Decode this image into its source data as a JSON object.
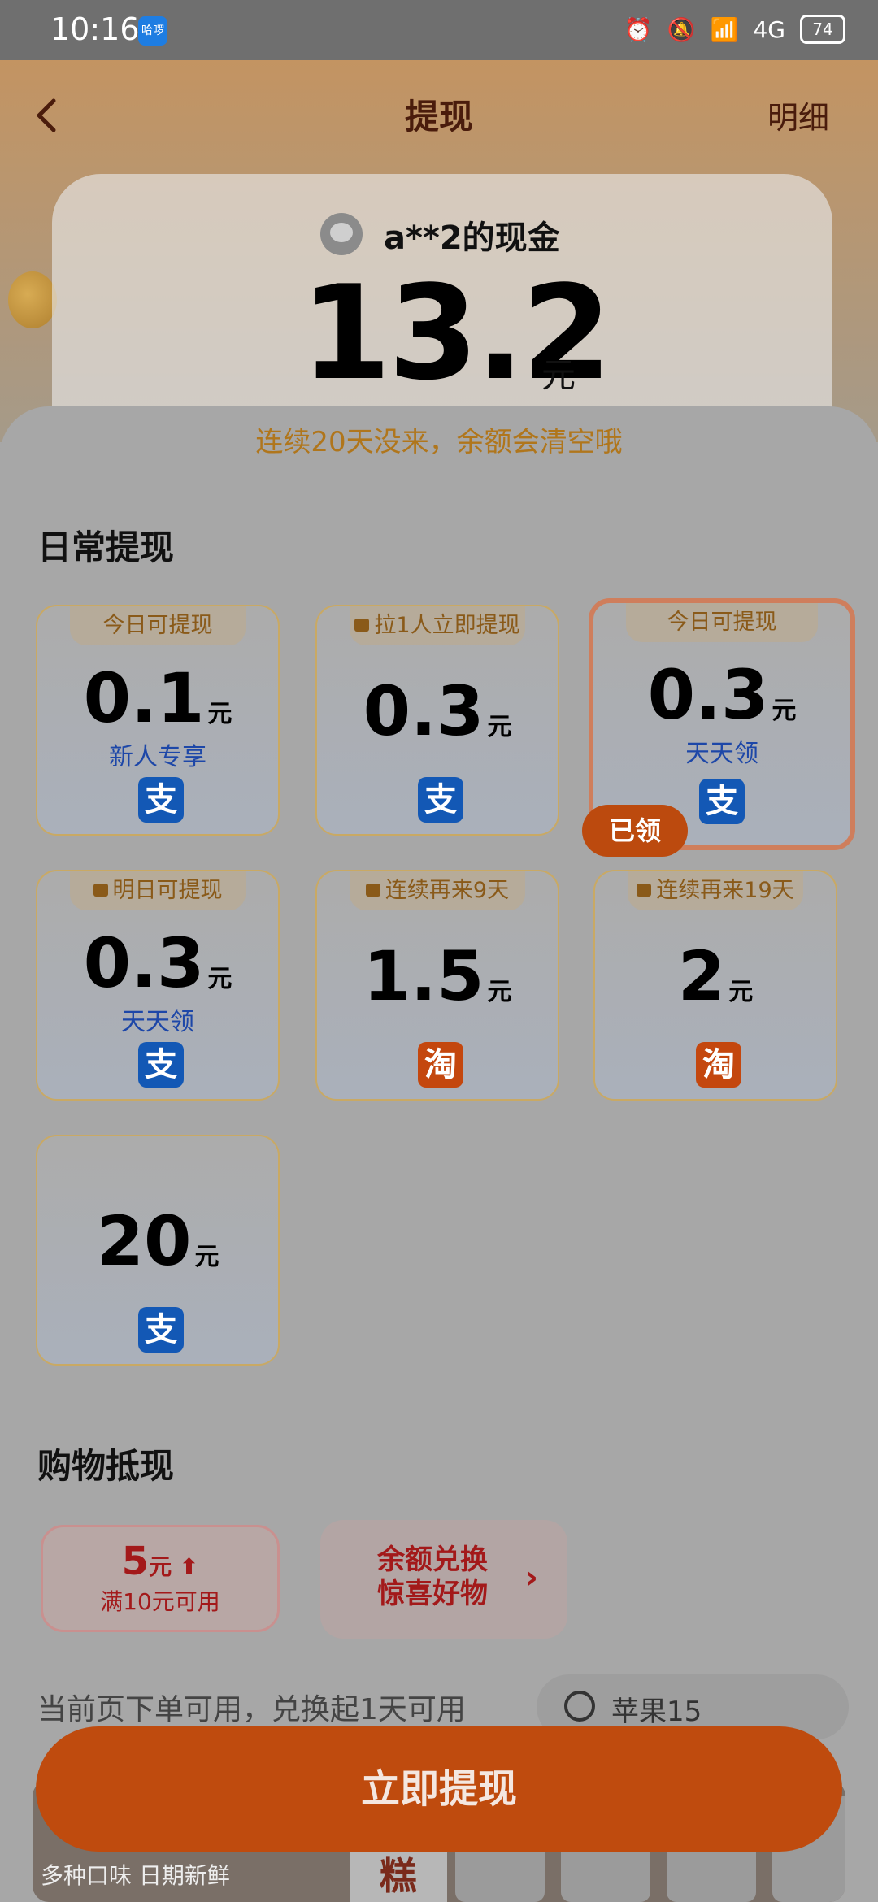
{
  "status_bar": {
    "time": "10:16",
    "app_badge": "哈啰",
    "network": "4G",
    "battery": "74"
  },
  "header": {
    "title": "提现",
    "detail_link": "明细"
  },
  "cash": {
    "owner_label": "a**2的现金",
    "amount": "13.2",
    "unit": "元",
    "warning": "连续20天没来，余额会清空哦"
  },
  "daily": {
    "section_title": "日常提现",
    "tiles": [
      {
        "tag": "今日可提现",
        "locked": false,
        "amount": "0.1",
        "unit": "元",
        "sub": "新人专享",
        "pay_icon": "支"
      },
      {
        "tag": "拉1人立即提现",
        "locked": true,
        "amount": "0.3",
        "unit": "元",
        "sub": "",
        "pay_icon": "支"
      },
      {
        "tag": "今日可提现",
        "locked": false,
        "amount": "0.3",
        "unit": "元",
        "sub": "天天领",
        "pay_icon": "支",
        "claimed_label": "已领"
      },
      {
        "tag": "明日可提现",
        "locked": true,
        "amount": "0.3",
        "unit": "元",
        "sub": "天天领",
        "pay_icon": "支"
      },
      {
        "tag": "连续再来9天",
        "locked": true,
        "amount": "1.5",
        "unit": "元",
        "sub": "",
        "pay_icon": "淘"
      },
      {
        "tag": "连续再来19天",
        "locked": true,
        "amount": "2",
        "unit": "元",
        "sub": "",
        "pay_icon": "淘"
      },
      {
        "tag": "",
        "locked": false,
        "amount": "20",
        "unit": "元",
        "sub": "",
        "pay_icon": "支"
      }
    ]
  },
  "shopping": {
    "section_title": "购物抵现",
    "voucher": {
      "amount": "5",
      "unit": "元",
      "condition": "满10元可用"
    },
    "exchange": {
      "line1": "余额兑换",
      "line2": "惊喜好物",
      "chevron": "›"
    },
    "note": "当前页下单可用，兑换起1天可用",
    "search_text": "苹果15",
    "banner_text": "多种口味  日期新鲜",
    "banner_badge": "苹果糕"
  },
  "cta": {
    "label": "立即提现"
  },
  "colors": {
    "accent": "#bf4b0e",
    "alipay": "#1358b5",
    "taobao": "#c4470e"
  }
}
